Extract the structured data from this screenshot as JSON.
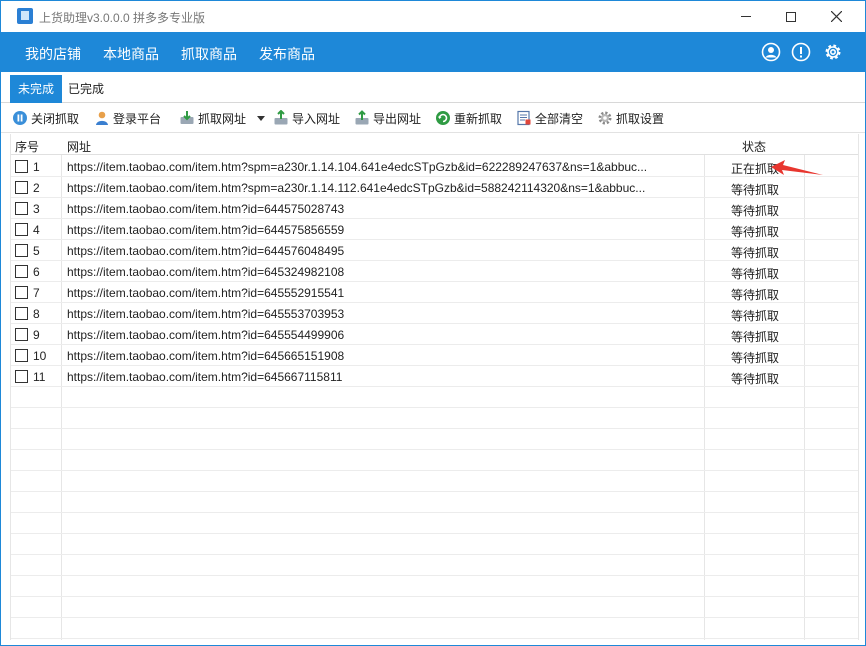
{
  "window": {
    "title": "上货助理v3.0.0.0 拼多多专业版"
  },
  "menu": {
    "items": [
      "我的店铺",
      "本地商品",
      "抓取商品",
      "发布商品"
    ]
  },
  "tabs": {
    "active": "未完成",
    "inactive": "已完成"
  },
  "toolbar": {
    "stop": "关闭抓取",
    "login": "登录平台",
    "fetch_url": "抓取网址",
    "import_url": "导入网址",
    "export_url": "导出网址",
    "refetch": "重新抓取",
    "clear_all": "全部清空",
    "settings": "抓取设置"
  },
  "table": {
    "headers": {
      "index": "序号",
      "url": "网址",
      "status": "状态"
    },
    "rows": [
      {
        "index": "1",
        "url": "https://item.taobao.com/item.htm?spm=a230r.1.14.104.641e4edcSTpGzb&id=622289247637&ns=1&abbuc...",
        "status": "正在抓取"
      },
      {
        "index": "2",
        "url": "https://item.taobao.com/item.htm?spm=a230r.1.14.112.641e4edcSTpGzb&id=588242114320&ns=1&abbuc...",
        "status": "等待抓取"
      },
      {
        "index": "3",
        "url": "https://item.taobao.com/item.htm?id=644575028743",
        "status": "等待抓取"
      },
      {
        "index": "4",
        "url": "https://item.taobao.com/item.htm?id=644575856559",
        "status": "等待抓取"
      },
      {
        "index": "5",
        "url": "https://item.taobao.com/item.htm?id=644576048495",
        "status": "等待抓取"
      },
      {
        "index": "6",
        "url": "https://item.taobao.com/item.htm?id=645324982108",
        "status": "等待抓取"
      },
      {
        "index": "7",
        "url": "https://item.taobao.com/item.htm?id=645552915541",
        "status": "等待抓取"
      },
      {
        "index": "8",
        "url": "https://item.taobao.com/item.htm?id=645553703953",
        "status": "等待抓取"
      },
      {
        "index": "9",
        "url": "https://item.taobao.com/item.htm?id=645554499906",
        "status": "等待抓取"
      },
      {
        "index": "10",
        "url": "https://item.taobao.com/item.htm?id=645665151908",
        "status": "等待抓取"
      },
      {
        "index": "11",
        "url": "https://item.taobao.com/item.htm?id=645667115811",
        "status": "等待抓取"
      }
    ],
    "empty_rows": 12
  },
  "colors": {
    "accent": "#1e88d8",
    "arrow": "#e8362f"
  },
  "icons": [
    "app-icon",
    "user-icon",
    "info-icon",
    "gear-icon",
    "pause-icon",
    "person-icon",
    "download-icon",
    "import-icon",
    "export-icon",
    "refresh-icon",
    "clear-icon",
    "settings-icon"
  ]
}
